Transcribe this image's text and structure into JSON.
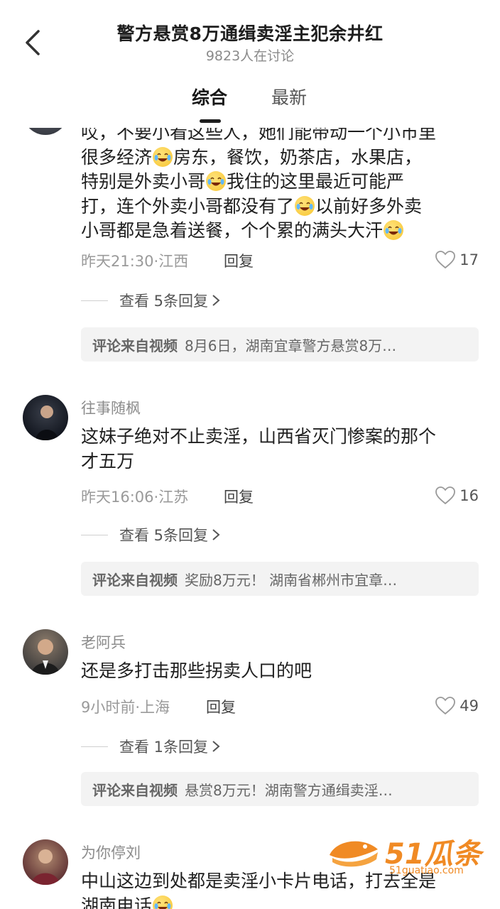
{
  "header": {
    "title": "警方悬赏8万通缉卖淫主犯余井红",
    "subtitle": "9823人在讨论",
    "back_icon": "chevron-left-icon"
  },
  "tabs": [
    {
      "label": "综合",
      "active": true
    },
    {
      "label": "最新",
      "active": false
    }
  ],
  "comments": [
    {
      "lines": [
        [
          "哎，不要小看这些人，她们能带动一个小市里"
        ],
        [
          "很多经济",
          "🤣",
          "房东，餐饮，奶茶店，水果店，"
        ],
        [
          "特别是外卖小哥",
          "🤣",
          "我住的这里最近可能严"
        ],
        [
          "打，连个外卖小哥都没有了",
          "🤣",
          "以前好多外卖"
        ],
        [
          "小哥都是急着送餐，个个累的满头大汗",
          "🤣"
        ]
      ],
      "meta": "昨天21:30·江西",
      "reply": "回复",
      "likes": "17",
      "view_replies": "查看 5条回复",
      "source_label": "评论来自视频",
      "source_text": "8月6日，湖南宜章警方悬赏8万…"
    },
    {
      "username": "往事随枫",
      "lines": [
        [
          "这妹子绝对不止卖淫，山西省灭门惨案的那个"
        ],
        [
          "才五万"
        ]
      ],
      "meta": "昨天16:06·江苏",
      "reply": "回复",
      "likes": "16",
      "view_replies": "查看 5条回复",
      "source_label": "评论来自视频",
      "source_text": "奖励8万元！ 湖南省郴州市宜章…"
    },
    {
      "username": "老阿兵",
      "lines": [
        [
          "还是多打击那些拐卖人口的吧"
        ]
      ],
      "meta": "9小时前·上海",
      "reply": "回复",
      "likes": "49",
      "view_replies": "查看 1条回复",
      "source_label": "评论来自视频",
      "source_text": "悬赏8万元！湖南警方通缉卖淫…"
    },
    {
      "username": "为你停刘",
      "lines": [
        [
          "中山这边到处都是卖淫小卡片电话，打去全是"
        ],
        [
          "湖南电话",
          "😭"
        ]
      ]
    }
  ],
  "watermark": {
    "main": "51瓜条",
    "sub": "51guatiao.com"
  },
  "colors": {
    "emoji": "#f7c531",
    "watermark": "#f08a24",
    "source_bg": "#f3f3f3"
  }
}
